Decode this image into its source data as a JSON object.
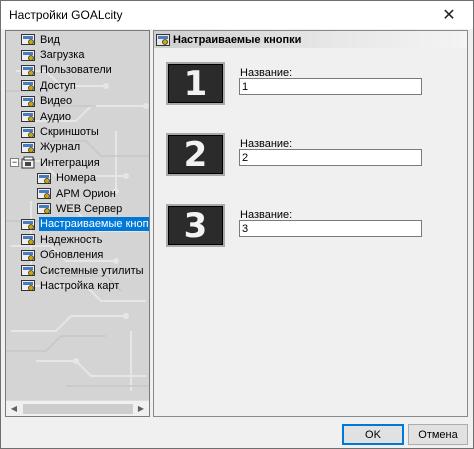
{
  "window": {
    "title": "Настройки GOALcity",
    "close_glyph": "✕"
  },
  "tree": {
    "items": [
      {
        "label": "Вид",
        "level": 0,
        "icon": "settings-icon"
      },
      {
        "label": "Загрузка",
        "level": 0,
        "icon": "settings-icon"
      },
      {
        "label": "Пользователи",
        "level": 0,
        "icon": "settings-icon"
      },
      {
        "label": "Доступ",
        "level": 0,
        "icon": "settings-icon"
      },
      {
        "label": "Видео",
        "level": 0,
        "icon": "settings-icon"
      },
      {
        "label": "Аудио",
        "level": 0,
        "icon": "settings-icon"
      },
      {
        "label": "Скриншоты",
        "level": 0,
        "icon": "settings-icon"
      },
      {
        "label": "Журнал",
        "level": 0,
        "icon": "settings-icon"
      },
      {
        "label": "Интеграция",
        "level": 0,
        "icon": "folder-icon",
        "expanded": true
      },
      {
        "label": "Номера",
        "level": 1,
        "icon": "settings-icon"
      },
      {
        "label": "АРМ Орион",
        "level": 1,
        "icon": "settings-icon"
      },
      {
        "label": "WEB Сервер",
        "level": 1,
        "icon": "settings-icon"
      },
      {
        "label": "Настраиваемые кнопки",
        "level": 0,
        "icon": "settings-icon",
        "selected": true
      },
      {
        "label": "Надежность",
        "level": 0,
        "icon": "settings-icon"
      },
      {
        "label": "Обновления",
        "level": 0,
        "icon": "settings-icon"
      },
      {
        "label": "Системные утилиты",
        "level": 0,
        "icon": "settings-icon"
      },
      {
        "label": "Настройка карт",
        "level": 0,
        "icon": "settings-icon"
      }
    ],
    "expander_glyph": "−"
  },
  "panel": {
    "title": "Настраиваемые кнопки",
    "buttons": [
      {
        "digit": "1",
        "name_label": "Название:",
        "value": "1"
      },
      {
        "digit": "2",
        "name_label": "Название:",
        "value": "2"
      },
      {
        "digit": "3",
        "name_label": "Название:",
        "value": "3"
      }
    ]
  },
  "footer": {
    "ok_label": "OK",
    "cancel_label": "Отмена"
  },
  "colors": {
    "selection": "#0078d7",
    "card_bg": "#2b2b2b"
  }
}
